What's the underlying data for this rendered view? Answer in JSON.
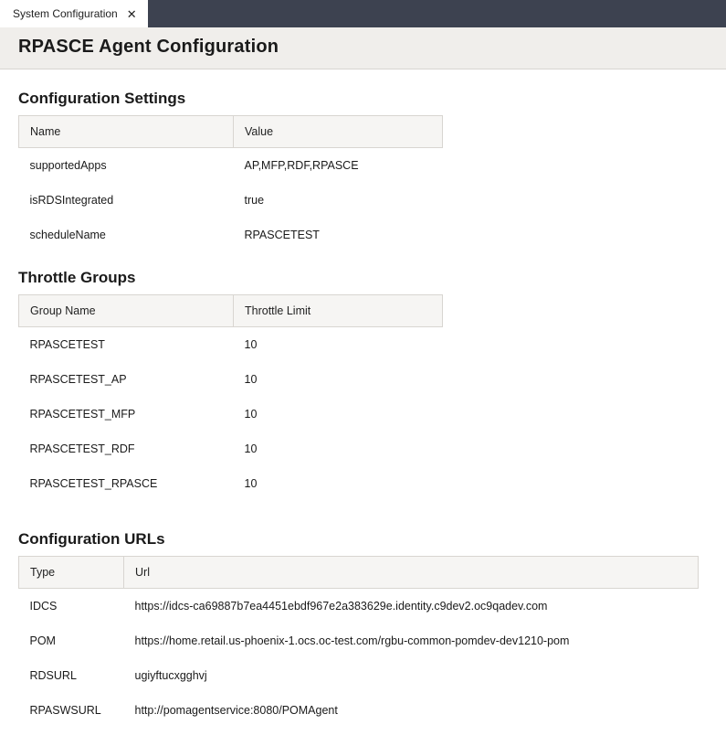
{
  "tab": {
    "label": "System Configuration"
  },
  "page": {
    "title": "RPASCE Agent Configuration"
  },
  "sections": {
    "settings": {
      "title": "Configuration Settings",
      "columns": [
        "Name",
        "Value"
      ],
      "rows": [
        {
          "name": "supportedApps",
          "value": "AP,MFP,RDF,RPASCE"
        },
        {
          "name": "isRDSIntegrated",
          "value": "true"
        },
        {
          "name": "scheduleName",
          "value": "RPASCETEST"
        }
      ]
    },
    "throttle": {
      "title": "Throttle Groups",
      "columns": [
        "Group Name",
        "Throttle Limit"
      ],
      "rows": [
        {
          "name": "RPASCETEST",
          "value": "10"
        },
        {
          "name": "RPASCETEST_AP",
          "value": "10"
        },
        {
          "name": "RPASCETEST_MFP",
          "value": "10"
        },
        {
          "name": "RPASCETEST_RDF",
          "value": "10"
        },
        {
          "name": "RPASCETEST_RPASCE",
          "value": "10"
        }
      ]
    },
    "urls": {
      "title": "Configuration URLs",
      "columns": [
        "Type",
        "Url"
      ],
      "rows": [
        {
          "name": "IDCS",
          "value": "https://idcs-ca69887b7ea4451ebdf967e2a383629e.identity.c9dev2.oc9qadev.com"
        },
        {
          "name": "POM",
          "value": "https://home.retail.us-phoenix-1.ocs.oc-test.com/rgbu-common-pomdev-dev1210-pom"
        },
        {
          "name": "RDSURL",
          "value": "ugiyftucxgghvj"
        },
        {
          "name": "RPASWSURL",
          "value": "http://pomagentservice:8080/POMAgent"
        }
      ]
    }
  }
}
